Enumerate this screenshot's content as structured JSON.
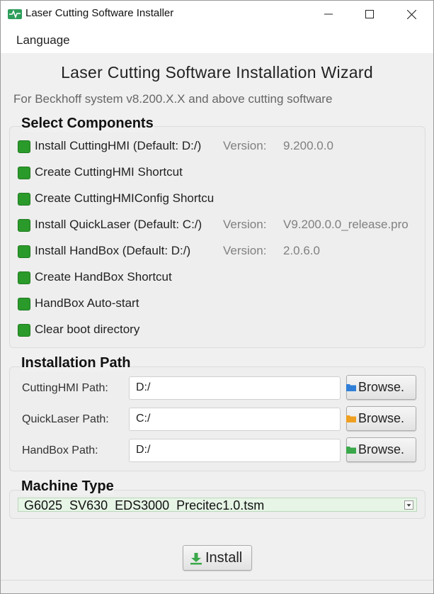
{
  "window": {
    "title": "Laser Cutting Software Installer",
    "controls": [
      "minimize",
      "maximize",
      "close"
    ]
  },
  "menu": {
    "language": "Language"
  },
  "header": {
    "title": "Laser Cutting Software Installation Wizard",
    "subtitle": "For Beckhoff system v8.200.X.X and above cutting software"
  },
  "components": {
    "title": "Select Components",
    "items": [
      {
        "label": "Install CuttingHMI (Default: D:/)",
        "version_label": "Version:",
        "version": "9.200.0.0",
        "checked": true
      },
      {
        "label": "Create CuttingHMI Shortcut",
        "checked": true
      },
      {
        "label": "Create CuttingHMIConfig Shortcut",
        "checked": true
      },
      {
        "label": "Install QuickLaser (Default: C:/)",
        "version_label": "Version:",
        "version": "V9.200.0.0_release.pro",
        "checked": true
      },
      {
        "label": "Install HandBox (Default: D:/)",
        "version_label": "Version:",
        "version": "2.0.6.0",
        "checked": true
      },
      {
        "label": "Create HandBox Shortcut",
        "checked": true
      },
      {
        "label": "HandBox Auto-start",
        "checked": true
      },
      {
        "label": "Clear boot directory",
        "checked": true
      }
    ]
  },
  "paths": {
    "title": "Installation Path",
    "browse_label": "Browse.",
    "rows": [
      {
        "label": "CuttingHMI Path:",
        "value": "D:/",
        "icon_color": "#2f7fd8"
      },
      {
        "label": "QuickLaser Path:",
        "value": "C:/",
        "icon_color": "#f0a020"
      },
      {
        "label": "HandBox Path:",
        "value": "D:/",
        "icon_color": "#3aa84a"
      }
    ]
  },
  "machine": {
    "title": "Machine Type",
    "selected": "G6025_SV630_EDS3000_Precitec1.0.tsm"
  },
  "install": {
    "label": "Install"
  },
  "colors": {
    "checkbox": "#2a9a2a",
    "accent_green": "#3aa84a"
  }
}
